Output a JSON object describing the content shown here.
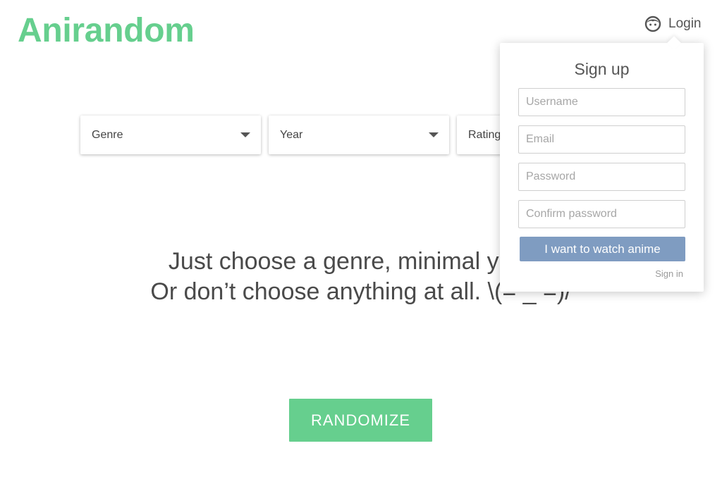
{
  "header": {
    "logo_text": "Anirandom",
    "login_label": "Login",
    "login_icon": "user-face-icon"
  },
  "filters": {
    "genre_label": "Genre",
    "year_label": "Year",
    "rating_label": "Rating"
  },
  "main": {
    "tagline_line1": "Just choose a genre, minimal year a",
    "tagline_line2": "Or don’t choose anything at all. \\(=   _   =)/",
    "randomize_label": "RANDOMIZE"
  },
  "signup": {
    "title": "Sign up",
    "username_placeholder": "Username",
    "email_placeholder": "Email",
    "password_placeholder": "Password",
    "confirm_placeholder": "Confirm password",
    "submit_label": "I want to watch anime",
    "signin_link": "Sign in"
  },
  "colors": {
    "brand_green": "#66cf8e",
    "submit_blue": "#7f9cc1"
  }
}
